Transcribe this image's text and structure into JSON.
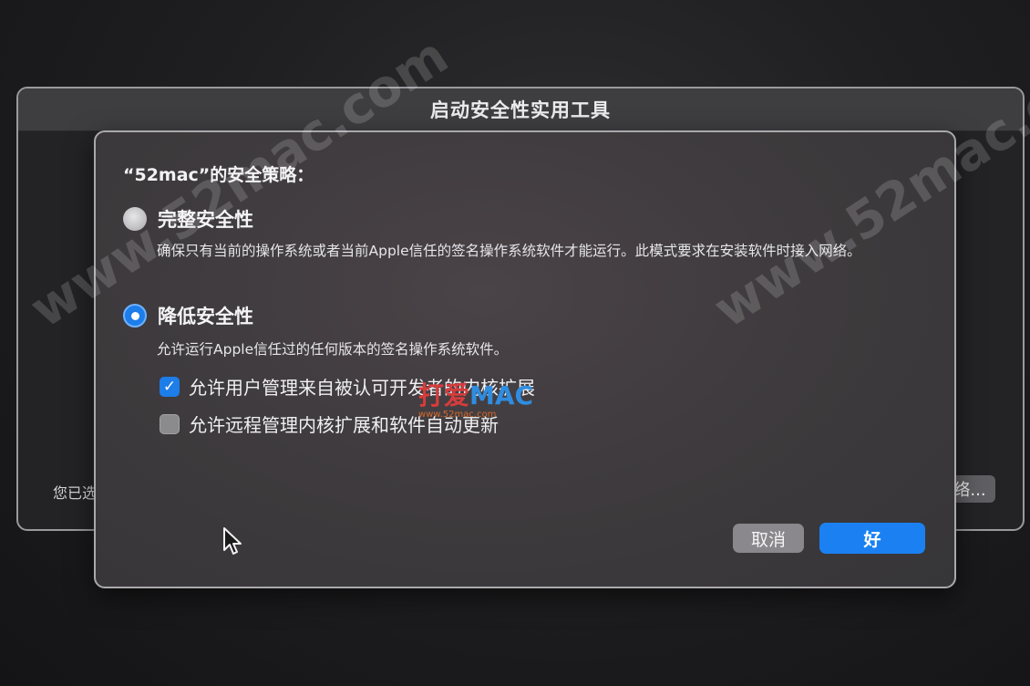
{
  "main_window": {
    "title": "启动安全性实用工具",
    "partial_label": "您已选",
    "partial_button": "络..."
  },
  "sheet": {
    "heading": "“52mac”的安全策略：",
    "full_security": {
      "label": "完整安全性",
      "description": "确保只有当前的操作系统或者当前Apple信任的签名操作系统软件才能运行。此模式要求在安装软件时接入网络。",
      "selected": false
    },
    "reduced_security": {
      "label": "降低安全性",
      "description": "允许运行Apple信任过的任何版本的签名操作系统软件。",
      "selected": true
    },
    "options": [
      {
        "label": "允许用户管理来自被认可开发者的内核扩展",
        "checked": true
      },
      {
        "label": "允许远程管理内核扩展和软件自动更新",
        "checked": false
      }
    ],
    "buttons": {
      "cancel": "取消",
      "ok": "好"
    }
  },
  "watermarks": {
    "text": "www.52mac.com",
    "logo_a": "打爱",
    "logo_b": "MAC",
    "logo_sub": "www.52mac.com"
  },
  "colors": {
    "accent": "#1b81f2",
    "checkbox_checked": "#1d7de9"
  }
}
